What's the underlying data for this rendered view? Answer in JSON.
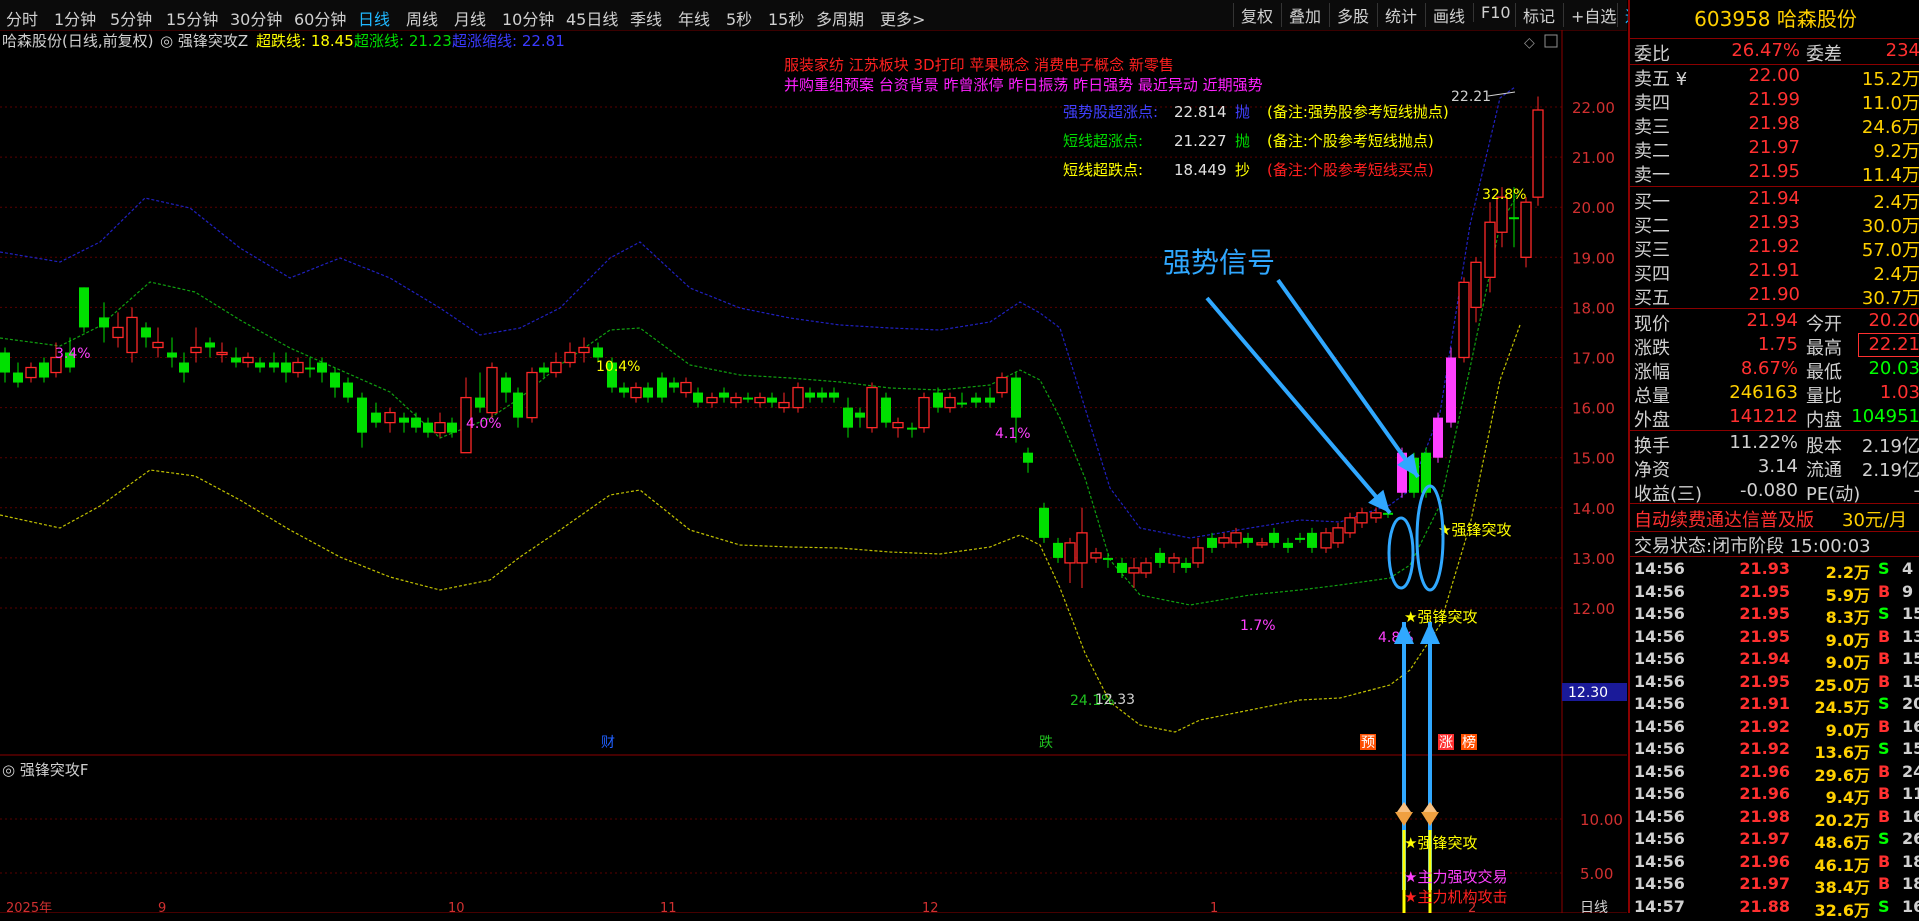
{
  "toolbar": {
    "periods": [
      "分时",
      "1分钟",
      "5分钟",
      "15分钟",
      "30分钟",
      "60分钟",
      "日线",
      "周线",
      "月线",
      "10分钟",
      "45日线",
      "季线",
      "年线",
      "5秒",
      "15秒",
      "多周期",
      "更多>"
    ],
    "active_period": "日线",
    "right_buttons": [
      "复权",
      "叠加",
      "多股",
      "统计",
      "画线",
      "F10",
      "标记",
      "+自选",
      "返回"
    ]
  },
  "chart_header": {
    "stock": "哈森股份(日线,前复权)",
    "indicator": "强锋突攻Z",
    "lines": [
      {
        "label": "超跌线: 18.45",
        "color": "#ffff00"
      },
      {
        "label": "超涨线: 21.23",
        "color": "#00dd00"
      },
      {
        "label": "超涨缩线: 22.81",
        "color": "#3a3aff"
      }
    ]
  },
  "concepts": {
    "line1": "服装家纺    江苏板块    3D打印 苹果概念 消费电子概念 新零售",
    "line2": "并购重组预案 台资背景 昨曾涨停 昨日振荡 昨日强势 最近异动 近期强势"
  },
  "points_table": [
    {
      "name": "强势股超涨点:",
      "value": "22.814",
      "action": "抛",
      "note": "(备注:强势股参考短线抛点)",
      "color": "#4040ff",
      "note_color": "#ffff00"
    },
    {
      "name": "短线超涨点:",
      "value": "21.227",
      "action": "抛",
      "note": "(备注:个股参考短线抛点)",
      "color": "#00dd00",
      "note_color": "#ffff00"
    },
    {
      "name": "短线超跌点:",
      "value": "18.449",
      "action": "抄",
      "note": "(备注:个股参考短线买点)",
      "color": "#ffff00",
      "note_color": "#ff2020"
    }
  ],
  "annotations": {
    "signal_text": "强势信号",
    "peak_price": "22.21",
    "low_price": "12.33",
    "current_price_tag": "12.30",
    "pct_labels": [
      "3.4%",
      "10.4%",
      "4.0%",
      "4.1%",
      "1.7%",
      "4.8%",
      "32.8%",
      "24.1%"
    ],
    "breakout_label": "强锋突攻",
    "event_markers": [
      "财",
      "跌",
      "预",
      "涨",
      "榜"
    ]
  },
  "price_axis": [
    "22.00",
    "21.00",
    "20.00",
    "19.00",
    "18.00",
    "17.00",
    "16.00",
    "15.00",
    "14.00",
    "13.00",
    "12.00"
  ],
  "sub_chart": {
    "title": "强锋突攻F",
    "axis": [
      "10.00",
      "5.00"
    ],
    "labels": [
      "强锋突攻",
      "主力强攻交易",
      "主力机构攻击"
    ]
  },
  "date_axis": [
    "2025年",
    "9",
    "10",
    "11",
    "12",
    "1",
    "2"
  ],
  "bottom_tab": "日线",
  "quote_panel": {
    "code": "603958",
    "name": "哈森股份",
    "header": {
      "wb_label": "委比",
      "wb_value": "26.47%",
      "wc_label": "委差",
      "wc_value": "234"
    },
    "asks": [
      {
        "label": "卖五 ¥",
        "price": "22.00",
        "vol": "15.2万"
      },
      {
        "label": "卖四",
        "price": "21.99",
        "vol": "11.0万"
      },
      {
        "label": "卖三",
        "price": "21.98",
        "vol": "24.6万"
      },
      {
        "label": "卖二",
        "price": "21.97",
        "vol": "9.2万"
      },
      {
        "label": "卖一",
        "price": "21.95",
        "vol": "11.4万"
      }
    ],
    "bids": [
      {
        "label": "买一",
        "price": "21.94",
        "vol": "2.4万"
      },
      {
        "label": "买二",
        "price": "21.93",
        "vol": "30.0万"
      },
      {
        "label": "买三",
        "price": "21.92",
        "vol": "57.0万"
      },
      {
        "label": "买四",
        "price": "21.91",
        "vol": "2.4万"
      },
      {
        "label": "买五",
        "price": "21.90",
        "vol": "30.7万"
      }
    ],
    "stats": [
      {
        "l1": "现价",
        "v1": "21.94",
        "c1": "#ff3030",
        "l2": "今开",
        "v2": "20.20",
        "c2": "#ff3030"
      },
      {
        "l1": "涨跌",
        "v1": "1.75",
        "c1": "#ff3030",
        "l2": "最高",
        "v2": "22.21",
        "c2": "#ff3030"
      },
      {
        "l1": "涨幅",
        "v1": "8.67%",
        "c1": "#ff3030",
        "l2": "最低",
        "v2": "20.03",
        "c2": "#00ff00"
      },
      {
        "l1": "总量",
        "v1": "246163",
        "c1": "#ffd000",
        "l2": "量比",
        "v2": "1.03",
        "c2": "#ff3030"
      },
      {
        "l1": "外盘",
        "v1": "141212",
        "c1": "#ff3030",
        "l2": "内盘",
        "v2": "104951",
        "c2": "#00ff00"
      }
    ],
    "stats2": [
      {
        "l1": "换手",
        "v1": "11.22%",
        "l2": "股本",
        "v2": "2.19亿"
      },
      {
        "l1": "净资",
        "v1": "3.14",
        "l2": "流通",
        "v2": "2.19亿"
      },
      {
        "l1": "收益(三)",
        "v1": "-0.080",
        "l2": "PE(动)",
        "v2": "-"
      }
    ],
    "ad_text": "自动续费通达信普及版",
    "ad_price": "30元/月",
    "trade_status": "交易状态:闭市阶段 15:00:03",
    "ticks": [
      {
        "time": "14:56",
        "price": "21.93",
        "vol": "2.2万",
        "side": "S",
        "n": "4"
      },
      {
        "time": "14:56",
        "price": "21.95",
        "vol": "5.9万",
        "side": "B",
        "n": "9"
      },
      {
        "time": "14:56",
        "price": "21.95",
        "vol": "8.3万",
        "side": "S",
        "n": "15"
      },
      {
        "time": "14:56",
        "price": "21.95",
        "vol": "9.0万",
        "side": "B",
        "n": "13"
      },
      {
        "time": "14:56",
        "price": "21.94",
        "vol": "9.0万",
        "side": "B",
        "n": "15"
      },
      {
        "time": "14:56",
        "price": "21.95",
        "vol": "25.0万",
        "side": "B",
        "n": "15"
      },
      {
        "time": "14:56",
        "price": "21.91",
        "vol": "24.5万",
        "side": "S",
        "n": "20"
      },
      {
        "time": "14:56",
        "price": "21.92",
        "vol": "9.0万",
        "side": "B",
        "n": "16"
      },
      {
        "time": "14:56",
        "price": "21.92",
        "vol": "13.6万",
        "side": "S",
        "n": "15"
      },
      {
        "time": "14:56",
        "price": "21.96",
        "vol": "29.6万",
        "side": "B",
        "n": "24"
      },
      {
        "time": "14:56",
        "price": "21.96",
        "vol": "9.4万",
        "side": "B",
        "n": "11"
      },
      {
        "time": "14:56",
        "price": "21.98",
        "vol": "20.2万",
        "side": "B",
        "n": "16"
      },
      {
        "time": "14:56",
        "price": "21.97",
        "vol": "48.6万",
        "side": "S",
        "n": "26"
      },
      {
        "time": "14:56",
        "price": "21.96",
        "vol": "46.1万",
        "side": "B",
        "n": "18"
      },
      {
        "time": "14:56",
        "price": "21.97",
        "vol": "38.4万",
        "side": "B",
        "n": "18"
      },
      {
        "time": "14:57",
        "price": "21.88",
        "vol": "32.6万",
        "side": "S",
        "n": "16"
      }
    ]
  }
}
